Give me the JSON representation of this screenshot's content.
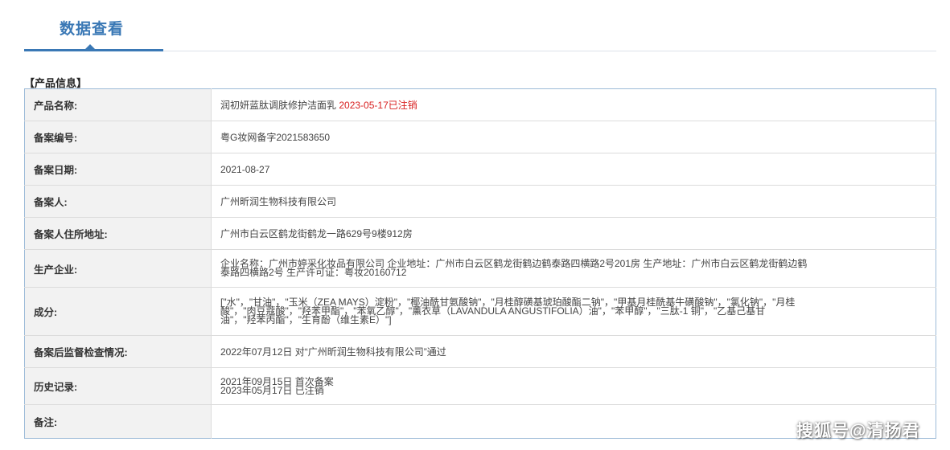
{
  "tab": {
    "title": "数据查看"
  },
  "section": {
    "title": "【产品信息】"
  },
  "rows": {
    "product_name": {
      "label": "产品名称:",
      "value": "润初妍蓝肽调肤修护洁面乳",
      "status": "2023-05-17已注销"
    },
    "record_no": {
      "label": "备案编号:",
      "value": "粤G妆网备字2021583650"
    },
    "record_date": {
      "label": "备案日期:",
      "value": "2021-08-27"
    },
    "registrant": {
      "label": "备案人:",
      "value": "广州昕润生物科技有限公司"
    },
    "address": {
      "label": "备案人住所地址:",
      "value": "广州市白云区鹤龙街鹤龙一路629号9楼912房"
    },
    "manufacturer": {
      "label": "生产企业:",
      "line1": "企业名称：广州市婷采化妆品有限公司 企业地址：广州市白云区鹤龙街鹤边鹤泰路四横路2号201房 生产地址：广州市白云区鹤龙街鹤边鹤",
      "line2": "泰路四横路2号 生产许可证：粤妆20160712"
    },
    "ingredients": {
      "label": "成分:",
      "line1": "[\"水\"，\"甘油\"，\"玉米（ZEA MAYS）淀粉\"，\"椰油酰甘氨酸钠\"，\"月桂醇磺基琥珀酸酯二钠\"，\"甲基月桂酰基牛磺酸钠\"，\"氯化钠\"，\"月桂",
      "line2": "酸\"，\"肉豆蔻酸\"，\"羟苯甲酯\"，\"苯氧乙醇\"，\"薰衣草（LAVANDULA ANGUSTIFOLIA）油\"，\"苯甲醇\"，\"三肽-1 铜\"，\"乙基己基甘",
      "line3": "油\"，\"羟苯丙酯\"，\"生育酚（维生素E）\"]"
    },
    "inspection": {
      "label": "备案后监督检查情况:",
      "value": "2022年07月12日 对“广州昕润生物科技有限公司”通过"
    },
    "history": {
      "label": "历史记录:",
      "line1": "2021年09月15日 首次备案",
      "line2": "2023年05月17日 已注销"
    },
    "notes": {
      "label": "备注:",
      "value": ""
    }
  },
  "watermark": "搜狐号@清扬君"
}
